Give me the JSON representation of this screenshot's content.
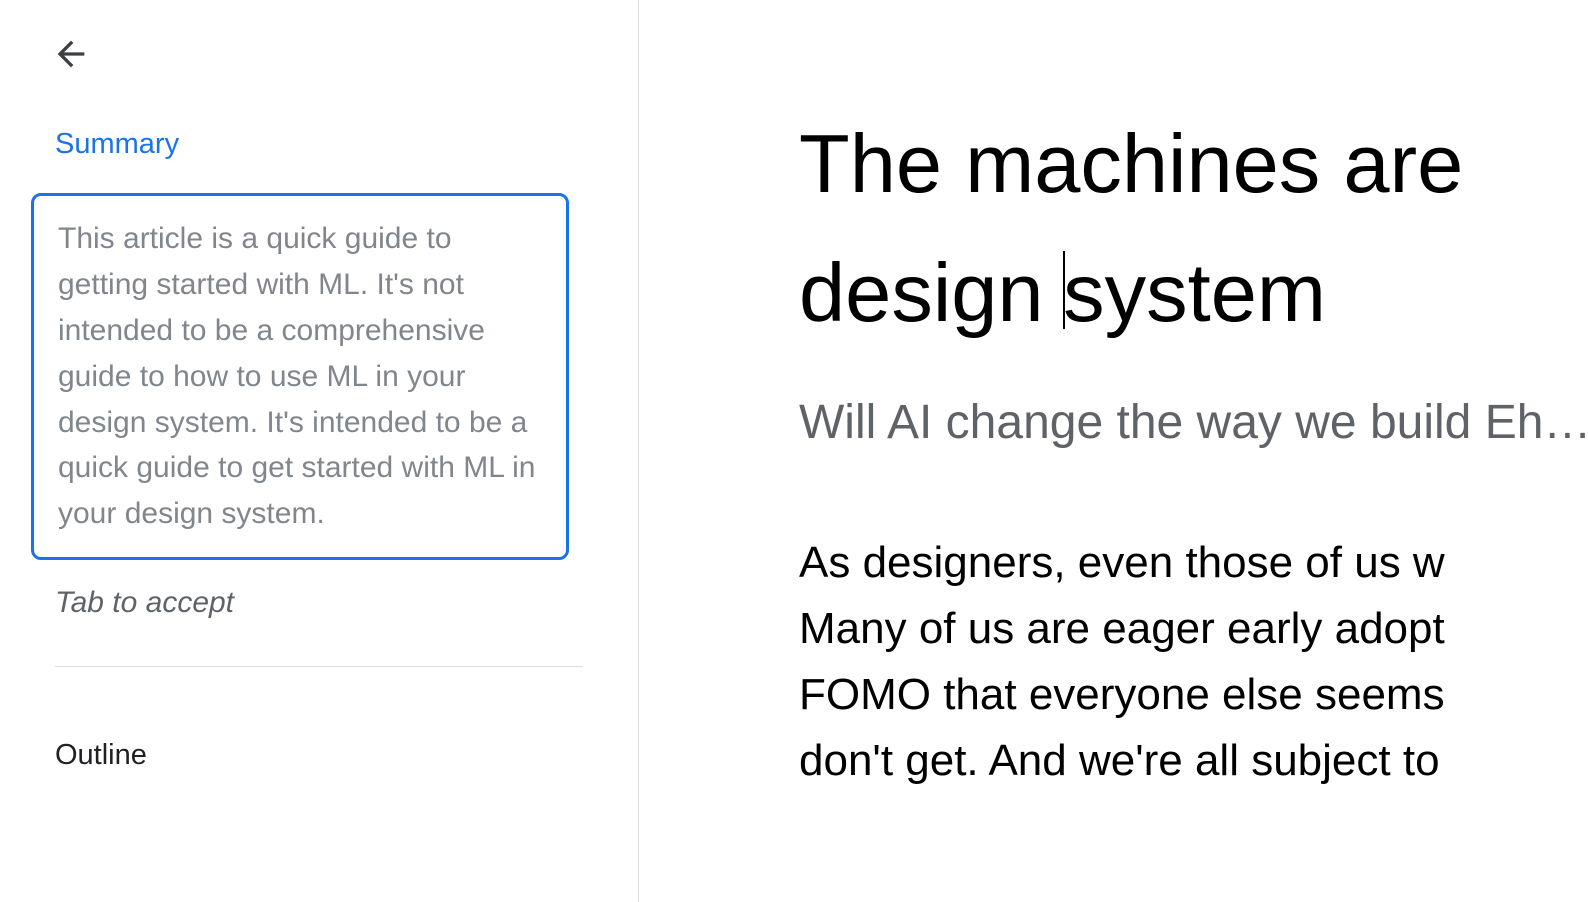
{
  "sidebar": {
    "summary_heading": "Summary",
    "summary_text": "This article is a quick guide to getting started with ML. It's not intended to be a comprehensive guide to how to use ML in your design system. It's intended to be a quick guide to get started with ML in your design system.",
    "tab_accept": "Tab to accept",
    "outline_heading": "Outline"
  },
  "document": {
    "title_line1": "The machines are",
    "title_line2a": "design ",
    "title_line2b": "system",
    "subtitle_line1": "Will AI change the way we build ",
    "subtitle_line2": "Eh…",
    "body_line1": "As designers, even those of us w",
    "body_line2": "Many of us are eager early adopt",
    "body_line3": "FOMO that everyone else seems",
    "body_line4": "don't get. And we're all subject to"
  },
  "colors": {
    "accent": "#1a73e8",
    "muted_text": "#80868b",
    "subtitle_text": "#5f6368",
    "border": "#dadce0",
    "body_text": "#000000"
  }
}
